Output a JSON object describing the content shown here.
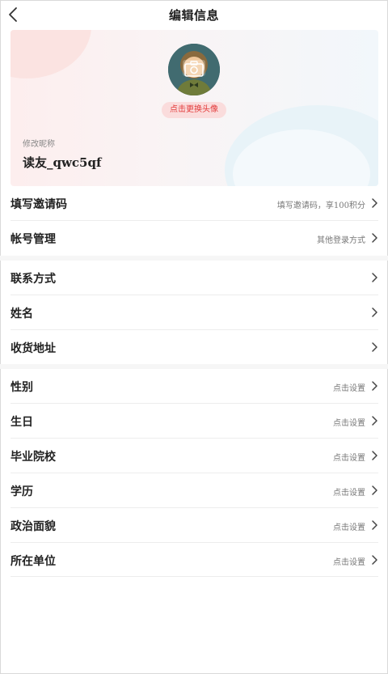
{
  "header": {
    "title": "编辑信息",
    "back_icon": "chevron-left-icon"
  },
  "profile": {
    "change_avatar_label": "点击更换头像",
    "nickname_label": "修改昵称",
    "nickname_value": "读友_qwc5qf",
    "camera_icon": "camera-icon"
  },
  "section1": [
    {
      "label": "填写邀请码",
      "value": "填写邀请码，享100积分"
    },
    {
      "label": "帐号管理",
      "value": "其他登录方式"
    }
  ],
  "section2": [
    {
      "label": "联系方式",
      "value": ""
    },
    {
      "label": "姓名",
      "value": ""
    },
    {
      "label": "收货地址",
      "value": ""
    }
  ],
  "section3": [
    {
      "label": "性别",
      "value": "点击设置"
    },
    {
      "label": "生日",
      "value": "点击设置"
    },
    {
      "label": "毕业院校",
      "value": "点击设置"
    },
    {
      "label": "学历",
      "value": "点击设置"
    },
    {
      "label": "政治面貌",
      "value": "点击设置"
    },
    {
      "label": "所在单位",
      "value": "点击设置"
    }
  ],
  "colors": {
    "accent": "#e33b3b",
    "pill_bg": "#fadcdc",
    "text": "#222222",
    "muted": "#777777"
  }
}
